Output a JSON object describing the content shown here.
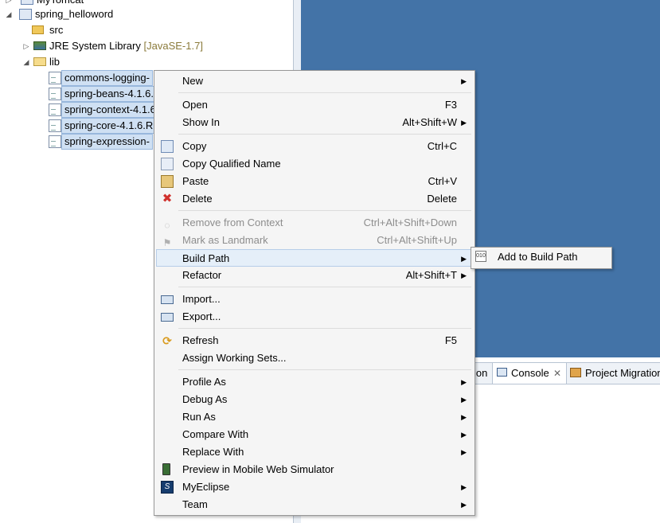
{
  "tree": {
    "partial_top": "MyTomcat",
    "project": "spring_helloword",
    "src": "src",
    "jre": "JRE System Library",
    "jre_version": "[JavaSE-1.7]",
    "lib": "lib",
    "jars": [
      "commons-logging-",
      "spring-beans-4.1.6.",
      "spring-context-4.1.6",
      "spring-core-4.1.6.R",
      "spring-expression-"
    ]
  },
  "views": {
    "tabs": [
      "ion",
      "Console",
      "Project Migration"
    ]
  },
  "context_menu": {
    "new": {
      "label": "New"
    },
    "open": {
      "label": "Open",
      "accel": "F3"
    },
    "show_in": {
      "label": "Show In",
      "accel": "Alt+Shift+W"
    },
    "copy": {
      "label": "Copy",
      "accel": "Ctrl+C"
    },
    "copy_qualified": {
      "label": "Copy Qualified Name"
    },
    "paste": {
      "label": "Paste",
      "accel": "Ctrl+V"
    },
    "delete": {
      "label": "Delete",
      "accel": "Delete"
    },
    "remove_context": {
      "label": "Remove from Context",
      "accel": "Ctrl+Alt+Shift+Down"
    },
    "mark_landmark": {
      "label": "Mark as Landmark",
      "accel": "Ctrl+Alt+Shift+Up"
    },
    "build_path": {
      "label": "Build Path"
    },
    "refactor": {
      "label": "Refactor",
      "accel": "Alt+Shift+T"
    },
    "import": {
      "label": "Import..."
    },
    "export": {
      "label": "Export..."
    },
    "refresh": {
      "label": "Refresh",
      "accel": "F5"
    },
    "assign_sets": {
      "label": "Assign Working Sets..."
    },
    "profile_as": {
      "label": "Profile As"
    },
    "debug_as": {
      "label": "Debug As"
    },
    "run_as": {
      "label": "Run As"
    },
    "compare_with": {
      "label": "Compare With"
    },
    "replace_with": {
      "label": "Replace With"
    },
    "preview_mobile": {
      "label": "Preview in Mobile Web Simulator"
    },
    "myeclipse": {
      "label": "MyEclipse"
    },
    "team": {
      "label": "Team"
    }
  },
  "submenu": {
    "add_build_path": "Add to Build Path"
  },
  "colors": {
    "editor_bg": "#4373a7",
    "menu_bg": "#f5f5f5",
    "highlight": "#e5eff9",
    "selection": "#cfe0f3"
  }
}
